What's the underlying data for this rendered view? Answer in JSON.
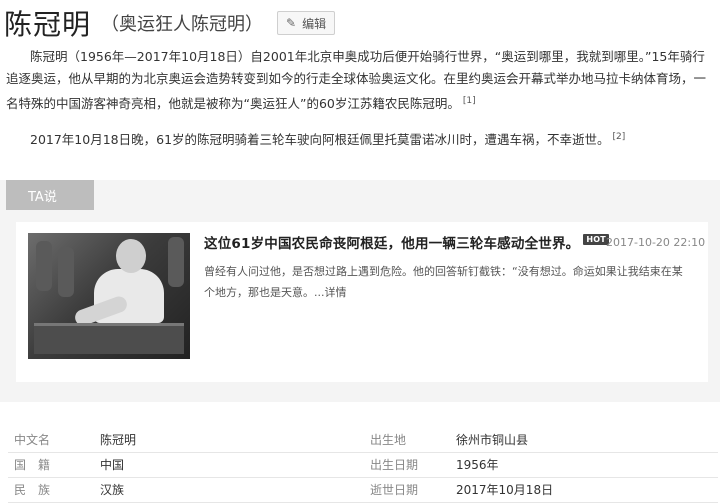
{
  "header": {
    "title": "陈冠明",
    "subtitle": "（奥运狂人陈冠明）",
    "edit_label": "编辑"
  },
  "summary": {
    "para1": "陈冠明（1956年—2017年10月18日）自2001年北京申奥成功后便开始骑行世界，“奥运到哪里，我就到哪里。”15年骑行追逐奥运，他从早期的为北京奥运会造势转变到如今的行走全球体验奥运文化。在里约奥运会开幕式举办地马拉卡纳体育场，一名特殊的中国游客神奇亮相，他就是被称为“奥运狂人”的60岁江苏籍农民陈冠明。",
    "ref1": "[1]",
    "para2": "2017年10月18日晚，61岁的陈冠明骑着三轮车驶向阿根廷佩里托莫雷诺冰川时，遭遇车祸，不幸逝世。",
    "ref2": "[2]"
  },
  "ta_section": {
    "tab_label": "TA说",
    "article": {
      "headline": "这位61岁中国农民命丧阿根廷，他用一辆三轮车感动全世界。",
      "badge": "HOT",
      "date": "2017-10-20 22:10",
      "excerpt": "曾经有人问过他，是否想过路上遇到危险。他的回答斩钉截铁：“没有想过。命运如果让我结束在某个地方，那也是天意。",
      "more_label": "...详情"
    }
  },
  "info_table": {
    "rows": [
      {
        "label1": "中文名",
        "value1": "陈冠明",
        "label2": "出生地",
        "value2": "徐州市铜山县"
      },
      {
        "label1": "国　籍",
        "value1": "中国",
        "label2": "出生日期",
        "value2": "1956年"
      },
      {
        "label1": "民　族",
        "value1": "汉族",
        "label2": "逝世日期",
        "value2": "2017年10月18日"
      }
    ]
  }
}
